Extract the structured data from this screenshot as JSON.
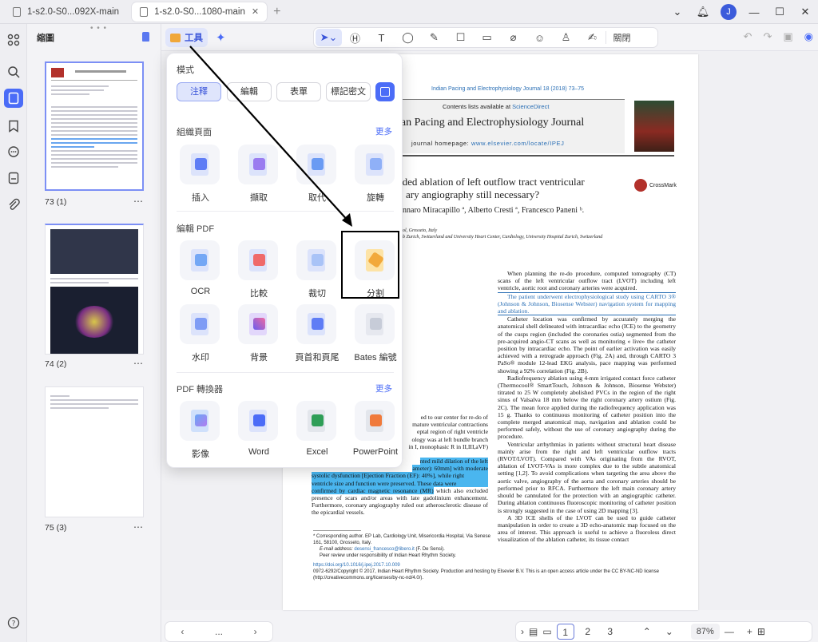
{
  "tabs": [
    {
      "title": "1-s2.0-S0...092X-main"
    },
    {
      "title": "1-s2.0-S0...1080-main"
    }
  ],
  "user": {
    "initial": "J"
  },
  "panel": {
    "title": "縮圖",
    "grip": "• • •"
  },
  "thumbnails": [
    {
      "label": "73 (1)"
    },
    {
      "label": "74 (2)"
    },
    {
      "label": "75 (3)"
    }
  ],
  "toolbar": {
    "tools_label": "工具",
    "close_label": "關閉"
  },
  "popup": {
    "mode_title": "模式",
    "modes": [
      "注釋",
      "編輯",
      "表單",
      "標記密文"
    ],
    "sections": [
      {
        "title": "組織頁面",
        "more": "更多",
        "items": [
          "插入",
          "擷取",
          "取代",
          "旋轉"
        ]
      },
      {
        "title": "編輯 PDF",
        "more": "",
        "items": [
          "OCR",
          "比較",
          "裁切",
          "分割",
          "水印",
          "背景",
          "頁首和頁尾",
          "Bates 編號"
        ]
      },
      {
        "title": "PDF 轉換器",
        "more": "更多",
        "items": [
          "影像",
          "Word",
          "Excel",
          "PowerPoint"
        ]
      }
    ]
  },
  "document": {
    "journal_ref": "Indian Pacing and Electrophysiology Journal 18 (2018) 73–75",
    "contents_prefix": "Contents lists available at ",
    "contents_link": "ScienceDirect",
    "journal_title": "ian Pacing and Electrophysiology Journal",
    "homepage_prefix": "journal homepage: ",
    "homepage_link": "www.elsevier.com/locate/IPEJ",
    "article_title_1": "ided ablation of left outflow tract ventricular",
    "article_title_2": "ary angiography still necessary?",
    "crossmark": "CrossMark",
    "authors": "nnaro Miracapillo ª, Alberto Cresti ª, Francesco Paneni ᵇ.",
    "aff1": "ol, Grosseto, Italy",
    "aff2": "b Zurich, Switzerland and University Heart Center, Cardiology, University Hospital Zurich, Switzerland",
    "right_p1": "When planning the re-do procedure, computed tomography (CT) scans of the left ventricular outflow tract (LVOT) including left ventricle, aortic root and coronary arteries were acquired.",
    "right_p2": "The patient underwent electrophysiological study using CARTO 3® (Johnson & Johnson, Biosense Webster) navigation system for mapping and ablation.",
    "right_p3": "Catheter location was confirmed by accurately merging the anatomical shell delineated with intracardiac echo (ICE) to the geometry of the cusps region (included the coronaries ostia) segmented from the pre-acquired angio-CT scans as well as monitoring « live» the catheter position by intracardiac echo. The point of earlier activation was easily achieved with a retrograde approach (Fig. 2A) and, through CARTO 3 PaSo® module 12-lead EKG analysis, pace mapping was performed showing a 92% correlation (Fig. 2B).",
    "right_p4": "Radiofrequency ablation using 4-mm irrigated contact force catheter (Thermocool® SmartTouch, Johnson & Johnson, Biosense Webster) titrated to 25 W completely abolished PVCs in the region of the right sinus of Valsalva 18 mm below the right coronary artery ostium (Fig. 2C). The mean force applied during the radiofrequency application was 15 g. Thanks to continuous monitoring of catheter position into the complete merged anatomical map, navigation and ablation could be performed safely, without the use of coronary angiography during the procedure.",
    "right_p5": "Ventricular arrhythmias in patients without structural heart disease mainly arise from the right and left ventricular outflow tracts (RVOT/LVOT). Compared with VAs originating from the RVOT, ablation of LVOT-VAs is more complex due to the subtle anatomical setting [1,2]. To avoid complications when targeting the area above the aortic valve, angiography of the aorta and coronary arteries should be performed prior to RFCA. Furthermore the left main coronary artery should be cannulated for the protection with an angiographic catheter. During ablation continuous fluoroscopic monitoring of catheter position is strongly suggested in the case of using 2D mapping [3].",
    "right_p6": "A 3D ICE shells of the LVOT can be used to guide catheter manipulation in order to create a 3D echo-anatomic map focused on the area of interest. This approach is useful to achieve a fluoroless direct visualization of the ablation catheter, its tissue contact",
    "left_frag_1": "ed to our center for re-do of",
    "left_frag_2": "mature ventricular contractions",
    "left_frag_3": "eptal region of right ventricle",
    "left_frag_4": "ology was at left bundle branch",
    "left_frag_5": "in I, monophasic R in II,III,aVF)",
    "left_hl_1": "nted mild dilation of the left",
    "left_hl_2": "ameter): 60mm] with moderate",
    "left_hl_3": "systolic dysfunction [Ejection Fraction (EF): 40%], while right",
    "left_hl_4": "ventricle size and function were preserved. These data were",
    "left_hl_5": "confirmed by cardiac magnetic resonance (MR)",
    "left_after_hl": " which also excluded presence of scars and/or areas with late gadolinium enhancement. Furthermore, coronary angiography ruled out atherosclerotic disease of the epicardial vessels.",
    "footnote_1": "* Corresponding author. EP Lab, Cardiology Unit, Misericordia Hospital, Via Senese 161, 58100, Grosseto, Italy.",
    "footnote_2_prefix": "E-mail address: ",
    "footnote_2_link": "desensi_francesco@libero.it",
    "footnote_2_suffix": " (F. De Sensi).",
    "footnote_3": "Peer review under responsibility of Indian Heart Rhythm Society.",
    "doi": "https://doi.org/10.1016/j.ipej.2017.10.009",
    "copyright": "0972-6292/Copyright © 2017, Indian Heart Rhythm Society. Production and hosting by Elsevier B.V. This is an open access article under the CC BY-NC-ND license (http://creativecommons.org/licenses/by-nc-nd/4.0/)."
  },
  "bottom": {
    "more": "...",
    "pages": [
      "1",
      "2",
      "3"
    ],
    "zoom": "87%"
  },
  "colors": {
    "accent": "#4b6cf7",
    "highlight": "#4ab6ef"
  }
}
